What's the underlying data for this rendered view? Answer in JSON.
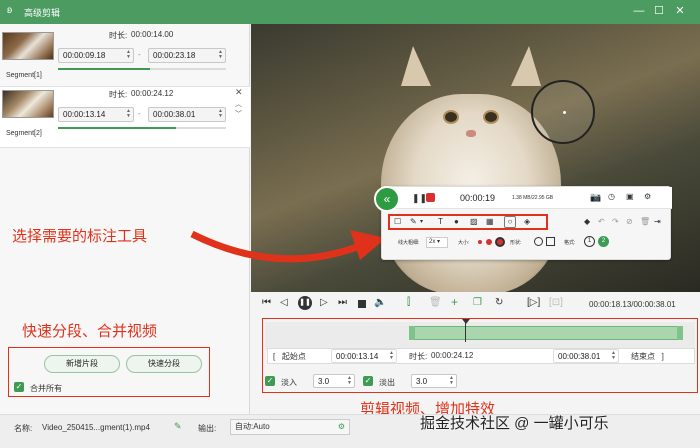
{
  "window": {
    "title": "高级剪辑",
    "minimize_icon": "—",
    "maximize_icon": "☐",
    "close_icon": "✕"
  },
  "segments": [
    {
      "label": "Segment[1]",
      "duration_label": "时长:",
      "duration": "00:00:14.00",
      "start": "00:00:09.18",
      "end": "00:00:23.18",
      "progress": 0.55
    },
    {
      "label": "Segment[2]",
      "duration_label": "时长:",
      "duration": "00:00:24.12",
      "start": "00:00:13.14",
      "end": "00:00:38.01",
      "progress": 0.7
    }
  ],
  "left_actions": {
    "add_segment": "新增片段",
    "quick_split": "快速分段",
    "merge_all": "合并所有"
  },
  "annotation_toolbar": {
    "time": "00:00:19",
    "file_size": "1.38 MB/22.95 GB",
    "line_width_label": "线大粗细:",
    "zoom": "2x",
    "size_label": "大小:",
    "shape_label": "形状:",
    "style_label": "格式:",
    "step1": "1",
    "step2": "2"
  },
  "playback": {
    "time_readout": "00:00:18.13/00:00:38.01"
  },
  "trim": {
    "start_point": "起始点",
    "start_time": "00:00:13.14",
    "duration_label": "时长:",
    "duration": "00:00:24.12",
    "end_time": "00:00:38.01",
    "end_point": "结束点",
    "fade_in_label": "淡入",
    "fade_in": "3.0",
    "fade_out_label": "淡出",
    "fade_out": "3.0"
  },
  "footer": {
    "name_label": "名称:",
    "name_value": "Video_250415...gment(1).mp4",
    "output_label": "输出:",
    "output_value": "自动:Auto"
  },
  "annotations": {
    "a1": "选择需要的标注工具",
    "a2": "快速分段、合并视频",
    "a3": "剪辑视频、增加特效"
  },
  "watermark": "掘金技术社区 @ 一罐小可乐",
  "colors": {
    "accent": "#4c9b61",
    "annotation_red": "#e0321b"
  }
}
